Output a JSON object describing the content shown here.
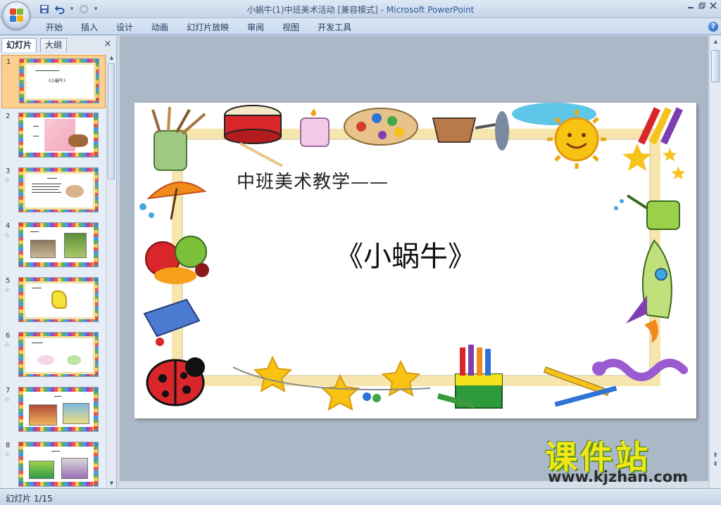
{
  "window": {
    "title_doc": "小蜗牛(1)中班美术活动 [兼容模式]",
    "title_sep": " - ",
    "title_app": "Microsoft PowerPoint"
  },
  "ribbon": {
    "tabs": [
      {
        "label": "开始"
      },
      {
        "label": "插入"
      },
      {
        "label": "设计"
      },
      {
        "label": "动画"
      },
      {
        "label": "幻灯片放映"
      },
      {
        "label": "审阅"
      },
      {
        "label": "视图"
      },
      {
        "label": "开发工具"
      }
    ],
    "help_label": "?"
  },
  "pane": {
    "tabs": [
      {
        "label": "幻灯片"
      },
      {
        "label": "大纲"
      }
    ],
    "close_label": "×",
    "thumbnails": [
      {
        "num": "1",
        "starred": false
      },
      {
        "num": "2",
        "starred": false
      },
      {
        "num": "3",
        "starred": true
      },
      {
        "num": "4",
        "starred": true
      },
      {
        "num": "5",
        "starred": true
      },
      {
        "num": "6",
        "starred": true
      },
      {
        "num": "7",
        "starred": true
      },
      {
        "num": "8",
        "starred": true
      }
    ],
    "thumb1_title": "《小蜗牛》",
    "star_glyph": "☆"
  },
  "slide": {
    "line1": "中班美术教学——",
    "line2": "《小蜗牛》"
  },
  "status": {
    "text": "幻灯片 1/15"
  },
  "watermark": {
    "cn": "课件站",
    "url": "www.kjzhan.com"
  },
  "colors": {
    "selected_thumb": "#fbd08f",
    "ribbon_text": "#1e395b",
    "frame_cream": "#f6e6ad"
  }
}
